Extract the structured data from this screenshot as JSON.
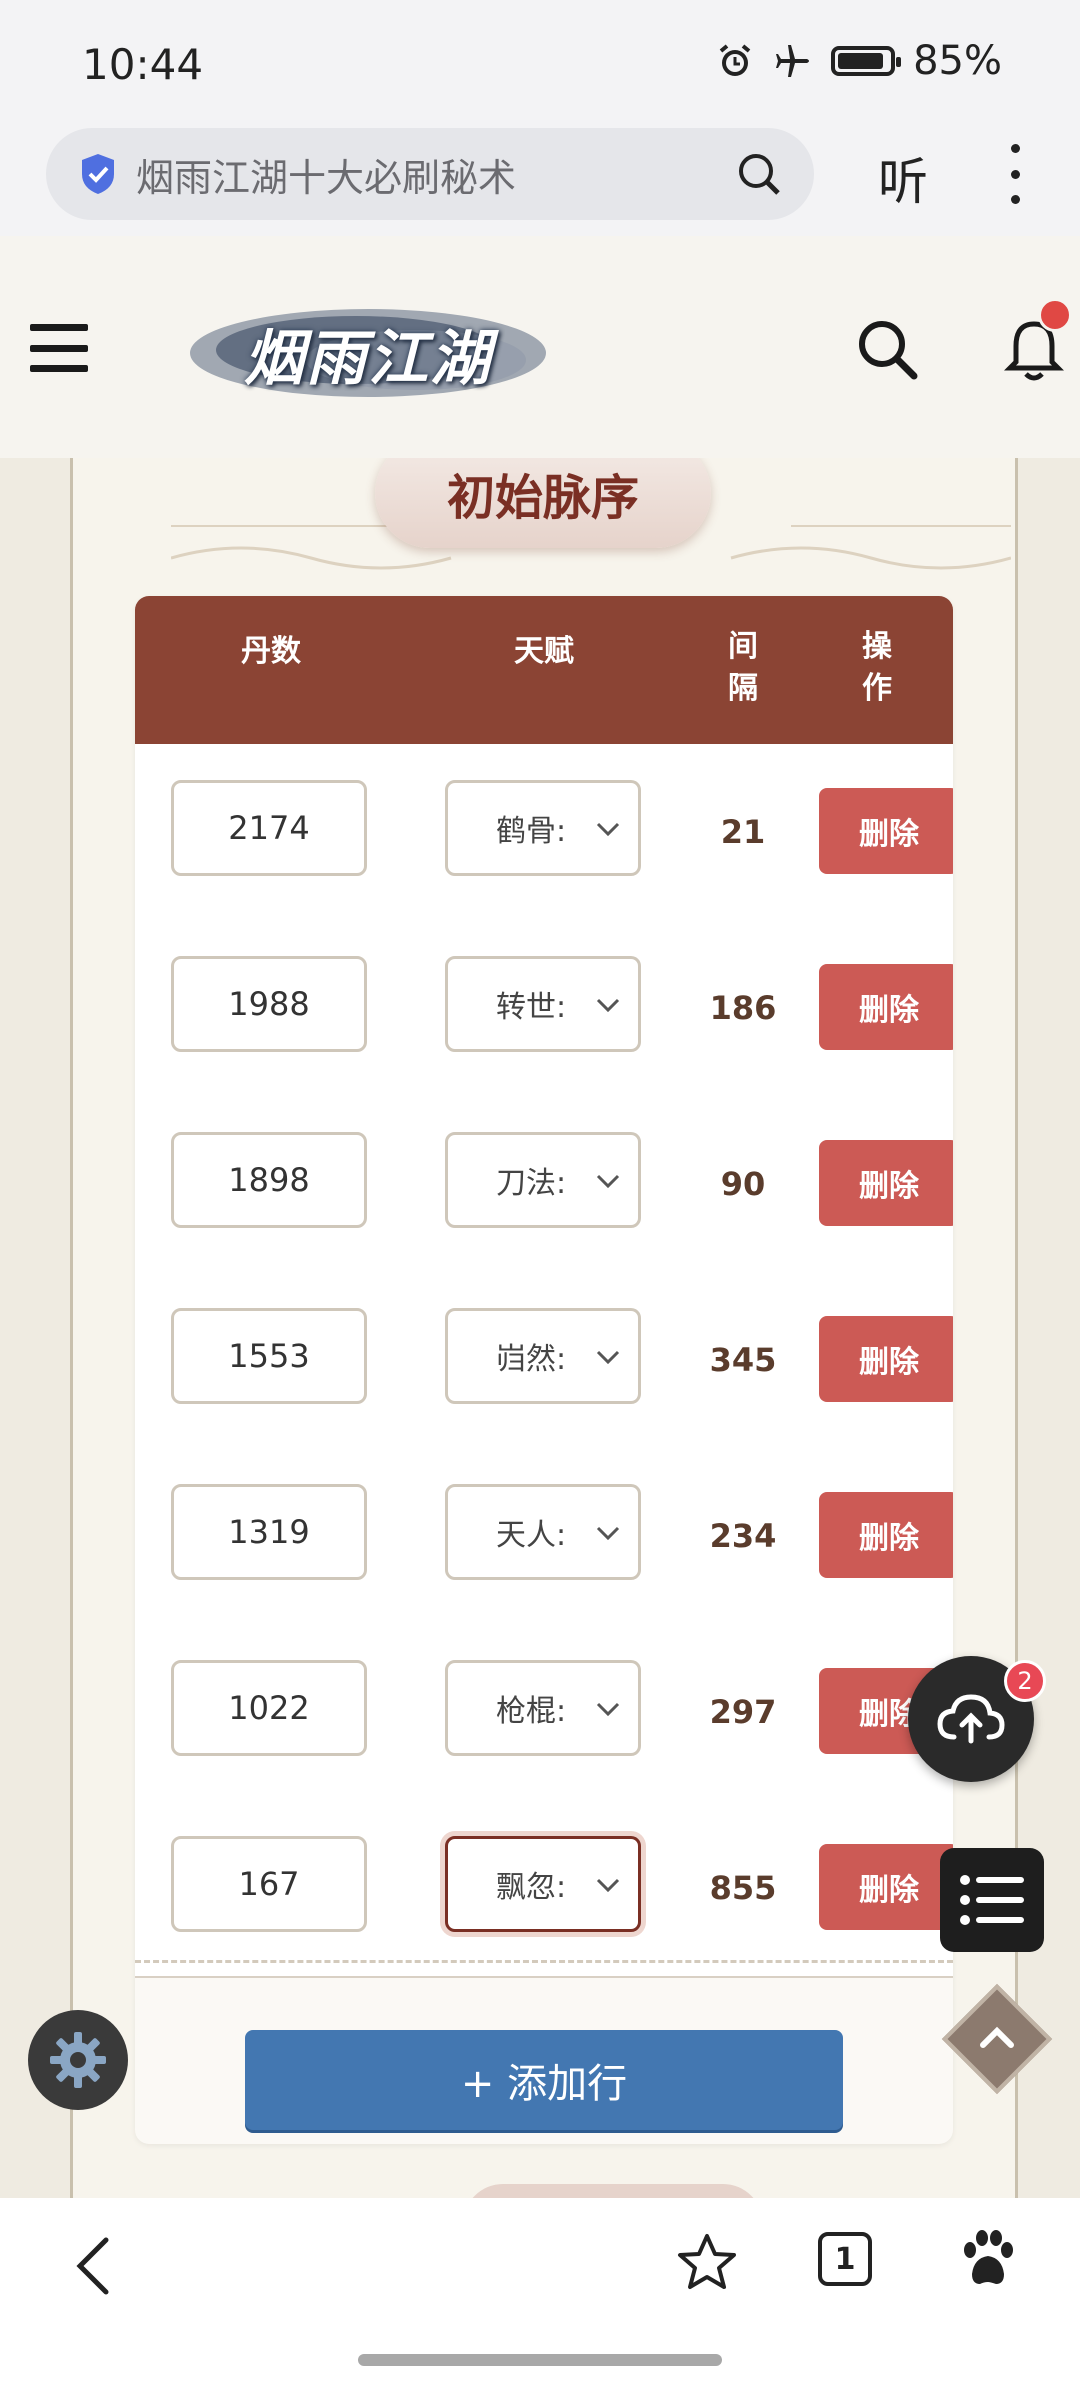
{
  "status": {
    "time": "10:44",
    "battery": "85%"
  },
  "browser": {
    "search_text": "烟雨江湖十大必刷秘术",
    "listen_label": "听"
  },
  "site": {
    "logo_text": "烟雨江湖"
  },
  "section": {
    "title": "初始脉序"
  },
  "table": {
    "headers": {
      "dan": "丹数",
      "tianfu": "天赋",
      "gap": "间\n隔",
      "op": "操\n作"
    },
    "rows": [
      {
        "dan": "2174",
        "tianfu": "鹤骨:",
        "gap": "21",
        "action": "删除"
      },
      {
        "dan": "1988",
        "tianfu": "转世:",
        "gap": "186",
        "action": "删除"
      },
      {
        "dan": "1898",
        "tianfu": "刀法:",
        "gap": "90",
        "action": "删除"
      },
      {
        "dan": "1553",
        "tianfu": "岿然:",
        "gap": "345",
        "action": "删除"
      },
      {
        "dan": "1319",
        "tianfu": "天人:",
        "gap": "234",
        "action": "删除"
      },
      {
        "dan": "1022",
        "tianfu": "枪棍:",
        "gap": "297",
        "action": "删除"
      },
      {
        "dan": "167",
        "tianfu": "飘忽:",
        "gap": "855",
        "action": "删除"
      }
    ],
    "add_row_label": "+ 添加行"
  },
  "floating": {
    "cloud_badge": "2"
  },
  "bottom": {
    "tab_count": "1"
  },
  "colors": {
    "header_brown": "#8b4434",
    "delete_red": "#cc5a55",
    "add_blue": "#4377b1"
  }
}
